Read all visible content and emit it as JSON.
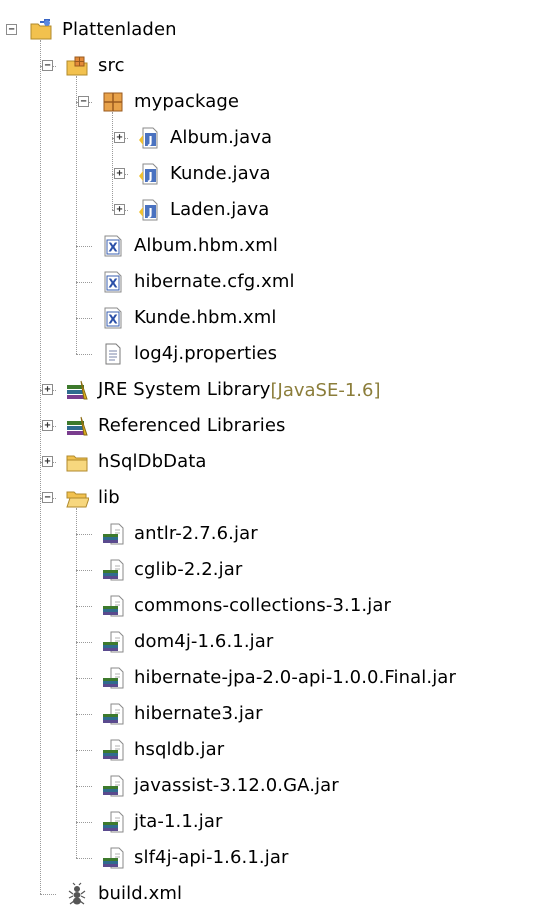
{
  "tree": [
    {
      "id": "n0",
      "label": "Plattenladen",
      "depth": 0,
      "icon": "project-icon",
      "expander": "minus"
    },
    {
      "id": "n1",
      "label": "src",
      "depth": 1,
      "icon": "source-folder-icon",
      "expander": "minus"
    },
    {
      "id": "n2",
      "label": "mypackage",
      "depth": 2,
      "icon": "package-icon",
      "expander": "minus"
    },
    {
      "id": "n3",
      "label": "Album.java",
      "depth": 3,
      "icon": "java-file-icon",
      "expander": "plus"
    },
    {
      "id": "n4",
      "label": "Kunde.java",
      "depth": 3,
      "icon": "java-file-icon",
      "expander": "plus"
    },
    {
      "id": "n5",
      "label": "Laden.java",
      "depth": 3,
      "icon": "java-file-icon",
      "expander": "plus"
    },
    {
      "id": "n6",
      "label": "Album.hbm.xml",
      "depth": 2,
      "icon": "xml-file-icon",
      "expander": "none"
    },
    {
      "id": "n7",
      "label": "hibernate.cfg.xml",
      "depth": 2,
      "icon": "xml-file-icon",
      "expander": "none"
    },
    {
      "id": "n8",
      "label": "Kunde.hbm.xml",
      "depth": 2,
      "icon": "xml-file-icon",
      "expander": "none"
    },
    {
      "id": "n9",
      "label": "log4j.properties",
      "depth": 2,
      "icon": "text-file-icon",
      "expander": "none"
    },
    {
      "id": "n10",
      "label": "JRE System Library",
      "decoration": "[JavaSE-1.6]",
      "depth": 1,
      "icon": "library-icon",
      "expander": "plus"
    },
    {
      "id": "n11",
      "label": "Referenced Libraries",
      "depth": 1,
      "icon": "library-icon",
      "expander": "plus"
    },
    {
      "id": "n12",
      "label": "hSqlDbData",
      "depth": 1,
      "icon": "folder-icon",
      "expander": "plus"
    },
    {
      "id": "n13",
      "label": "lib",
      "depth": 1,
      "icon": "folder-open-icon",
      "expander": "minus"
    },
    {
      "id": "n14",
      "label": "antlr-2.7.6.jar",
      "depth": 2,
      "icon": "jar-file-icon",
      "expander": "none"
    },
    {
      "id": "n15",
      "label": "cglib-2.2.jar",
      "depth": 2,
      "icon": "jar-file-icon",
      "expander": "none"
    },
    {
      "id": "n16",
      "label": "commons-collections-3.1.jar",
      "depth": 2,
      "icon": "jar-file-icon",
      "expander": "none"
    },
    {
      "id": "n17",
      "label": "dom4j-1.6.1.jar",
      "depth": 2,
      "icon": "jar-file-icon",
      "expander": "none"
    },
    {
      "id": "n18",
      "label": "hibernate-jpa-2.0-api-1.0.0.Final.jar",
      "depth": 2,
      "icon": "jar-file-icon",
      "expander": "none"
    },
    {
      "id": "n19",
      "label": "hibernate3.jar",
      "depth": 2,
      "icon": "jar-file-icon",
      "expander": "none"
    },
    {
      "id": "n20",
      "label": "hsqldb.jar",
      "depth": 2,
      "icon": "jar-file-icon",
      "expander": "none"
    },
    {
      "id": "n21",
      "label": "javassist-3.12.0.GA.jar",
      "depth": 2,
      "icon": "jar-file-icon",
      "expander": "none"
    },
    {
      "id": "n22",
      "label": "jta-1.1.jar",
      "depth": 2,
      "icon": "jar-file-icon",
      "expander": "none"
    },
    {
      "id": "n23",
      "label": "slf4j-api-1.6.1.jar",
      "depth": 2,
      "icon": "jar-file-icon",
      "expander": "none"
    },
    {
      "id": "n24",
      "label": "build.xml",
      "depth": 1,
      "icon": "ant-file-icon",
      "expander": "none"
    }
  ],
  "colors": {
    "decoration": "#8b7d3a",
    "lines": "#9a9a9a",
    "folder": "#f2c14e",
    "library": "#3d7a2c"
  }
}
